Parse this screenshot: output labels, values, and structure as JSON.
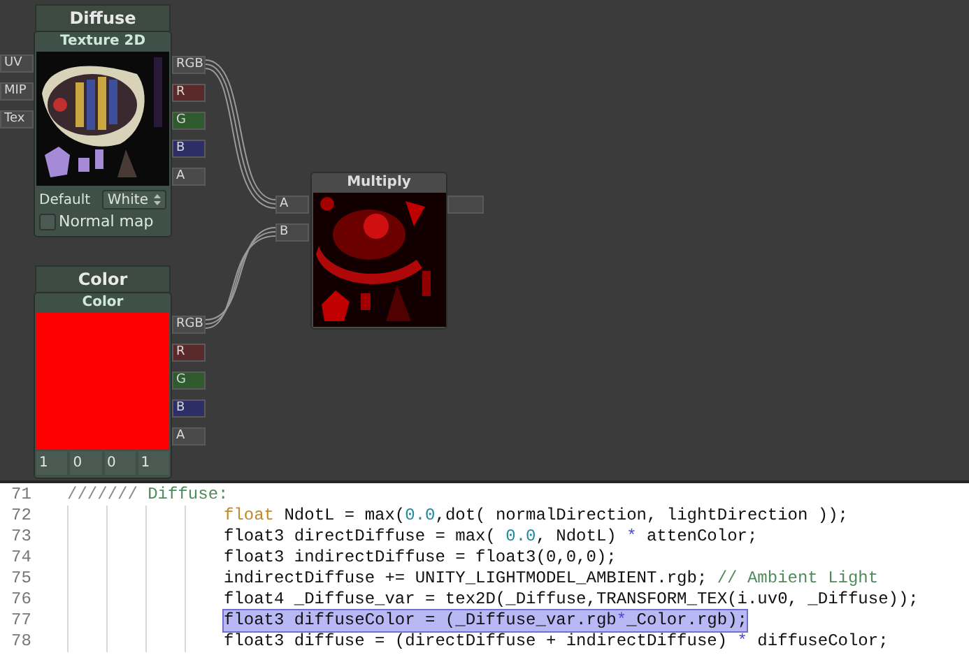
{
  "nodes": [
    {
      "kind": "texture",
      "title": "Diffuse",
      "subtitle": "Texture 2D",
      "inputs": [
        "UV",
        "MIP",
        "Tex"
      ],
      "outputs": [
        {
          "label": "RGB",
          "color": "#4a4a4a"
        },
        {
          "label": "R",
          "color": "#5a2a2a"
        },
        {
          "label": "G",
          "color": "#2e5a2e"
        },
        {
          "label": "B",
          "color": "#2e2e66"
        },
        {
          "label": "A",
          "color": "#4a4a4a"
        }
      ],
      "default_label": "Default",
      "dropdown": "White",
      "checkbox": {
        "label": "Normal map",
        "checked": false
      }
    },
    {
      "kind": "color",
      "title": "Color",
      "subtitle": "Color",
      "values": [
        "1",
        "0",
        "0",
        "1"
      ],
      "outputs": [
        {
          "label": "RGB",
          "color": "#4a4a4a"
        },
        {
          "label": "R",
          "color": "#5a2a2a"
        },
        {
          "label": "G",
          "color": "#2e5a2e"
        },
        {
          "label": "B",
          "color": "#2e2e66"
        },
        {
          "label": "A",
          "color": "#4a4a4a"
        }
      ]
    },
    {
      "kind": "multiply",
      "title": "Multiply",
      "inputs": [
        "A",
        "B"
      ]
    }
  ],
  "code": {
    "lines": [
      {
        "number": "71",
        "kind": "heading",
        "selected": false,
        "segments": [
          {
            "text": "/////// ",
            "kind": "slashes"
          },
          {
            "text": "Diffuse:",
            "kind": "comment"
          }
        ]
      },
      {
        "number": "72",
        "kind": "statement",
        "selected": false,
        "segments": [
          {
            "text": "float",
            "kind": "keyword"
          },
          {
            "text": " NdotL = max(",
            "kind": "plain"
          },
          {
            "text": "0.0",
            "kind": "number"
          },
          {
            "text": ",dot( normalDirection, lightDirection ));",
            "kind": "plain"
          }
        ]
      },
      {
        "number": "73",
        "kind": "statement",
        "selected": false,
        "segments": [
          {
            "text": "float3 directDiffuse = max( ",
            "kind": "plain"
          },
          {
            "text": "0.0",
            "kind": "number"
          },
          {
            "text": ", NdotL) ",
            "kind": "plain"
          },
          {
            "text": "*",
            "kind": "operator"
          },
          {
            "text": " attenColor;",
            "kind": "plain"
          }
        ]
      },
      {
        "number": "74",
        "kind": "statement",
        "selected": false,
        "segments": [
          {
            "text": "float3 indirectDiffuse = float3(0,0,0);",
            "kind": "plain"
          }
        ]
      },
      {
        "number": "75",
        "kind": "statement",
        "selected": false,
        "segments": [
          {
            "text": "indirectDiffuse += UNITY_LIGHTMODEL_AMBIENT.rgb; ",
            "kind": "plain"
          },
          {
            "text": "// Ambient Light",
            "kind": "comment"
          }
        ]
      },
      {
        "number": "76",
        "kind": "statement",
        "selected": false,
        "segments": [
          {
            "text": "float4 _Diffuse_var = tex2D(_Diffuse,TRANSFORM_TEX(i.uv0, _Diffuse));",
            "kind": "plain"
          }
        ]
      },
      {
        "number": "77",
        "kind": "statement",
        "selected": true,
        "segments": [
          {
            "text": "float3 diffuseColor = (_Diffuse_var.rgb",
            "kind": "plain"
          },
          {
            "text": "*",
            "kind": "operator"
          },
          {
            "text": "_Color.rgb);",
            "kind": "plain"
          }
        ]
      },
      {
        "number": "78",
        "kind": "statement",
        "selected": false,
        "segments": [
          {
            "text": "float3 diffuse = (directDiffuse + indirectDiffuse) ",
            "kind": "plain"
          },
          {
            "text": "*",
            "kind": "operator"
          },
          {
            "text": " diffuseColor;",
            "kind": "plain"
          }
        ]
      }
    ]
  }
}
